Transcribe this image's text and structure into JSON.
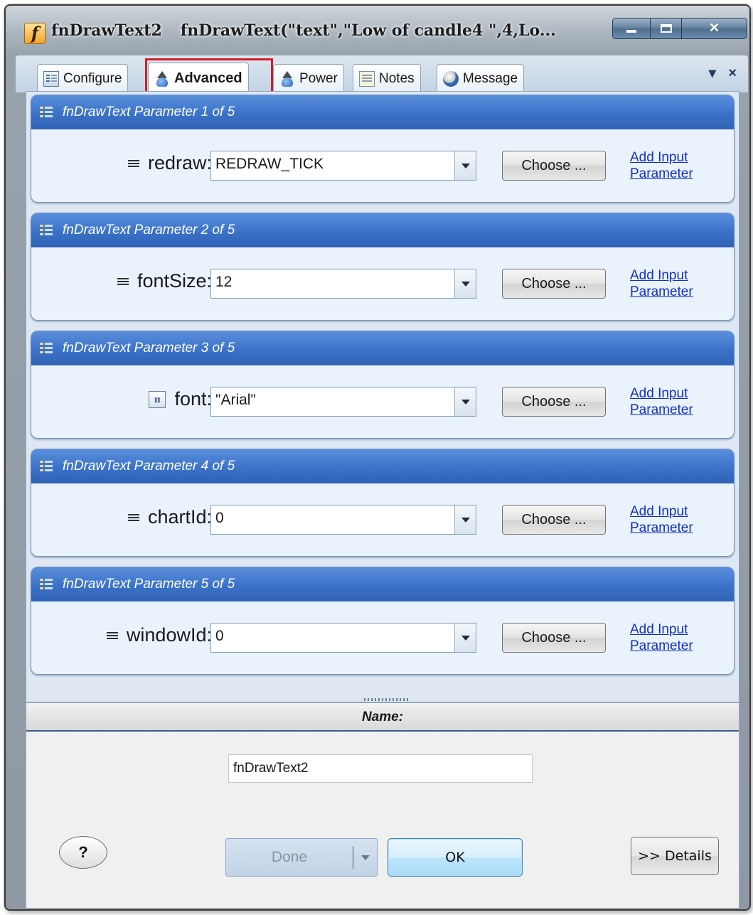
{
  "window": {
    "icon_letter": "f",
    "name": "fnDrawText2",
    "expression": "fnDrawText(\"text\",\"Low of candle4 \",4,Lo..."
  },
  "tabs": [
    {
      "label": "Configure",
      "icon": "configure-icon",
      "active": false
    },
    {
      "label": "Advanced",
      "icon": "wizard-icon",
      "active": true
    },
    {
      "label": "Power",
      "icon": "wizard-icon",
      "active": false
    },
    {
      "label": "Notes",
      "icon": "notes-icon",
      "active": false
    },
    {
      "label": "Message",
      "icon": "message-icon",
      "active": false
    }
  ],
  "tab_menu": "▾ ×",
  "params": [
    {
      "header": "fnDrawText Parameter 1 of 5",
      "label": "redraw:",
      "icon": "equals-icon",
      "value": "REDRAW_TICK",
      "choose": "Choose ...",
      "link1": "Add Input",
      "link2": "Parameter"
    },
    {
      "header": "fnDrawText Parameter 2 of 5",
      "label": "fontSize:",
      "icon": "equals-icon",
      "value": "12",
      "choose": "Choose ...",
      "link1": "Add Input",
      "link2": "Parameter"
    },
    {
      "header": "fnDrawText Parameter 3 of 5",
      "label": "font:",
      "icon": "font-icon",
      "value": "\"Arial\"",
      "choose": "Choose ...",
      "link1": "Add Input",
      "link2": "Parameter"
    },
    {
      "header": "fnDrawText Parameter 4 of 5",
      "label": "chartId:",
      "icon": "equals-icon",
      "value": "0",
      "choose": "Choose ...",
      "link1": "Add Input",
      "link2": "Parameter"
    },
    {
      "header": "fnDrawText Parameter 5 of 5",
      "label": "windowId:",
      "icon": "equals-icon",
      "value": "0",
      "choose": "Choose ...",
      "link1": "Add Input",
      "link2": "Parameter"
    }
  ],
  "bottom": {
    "name_header": "Name:",
    "name_value": "fnDrawText2",
    "help": "?",
    "done": "Done",
    "ok": "OK",
    "details": ">> Details"
  },
  "colors": {
    "highlight": "#d21d25",
    "header_blue": "#3b72c8",
    "link": "#1030c8"
  }
}
